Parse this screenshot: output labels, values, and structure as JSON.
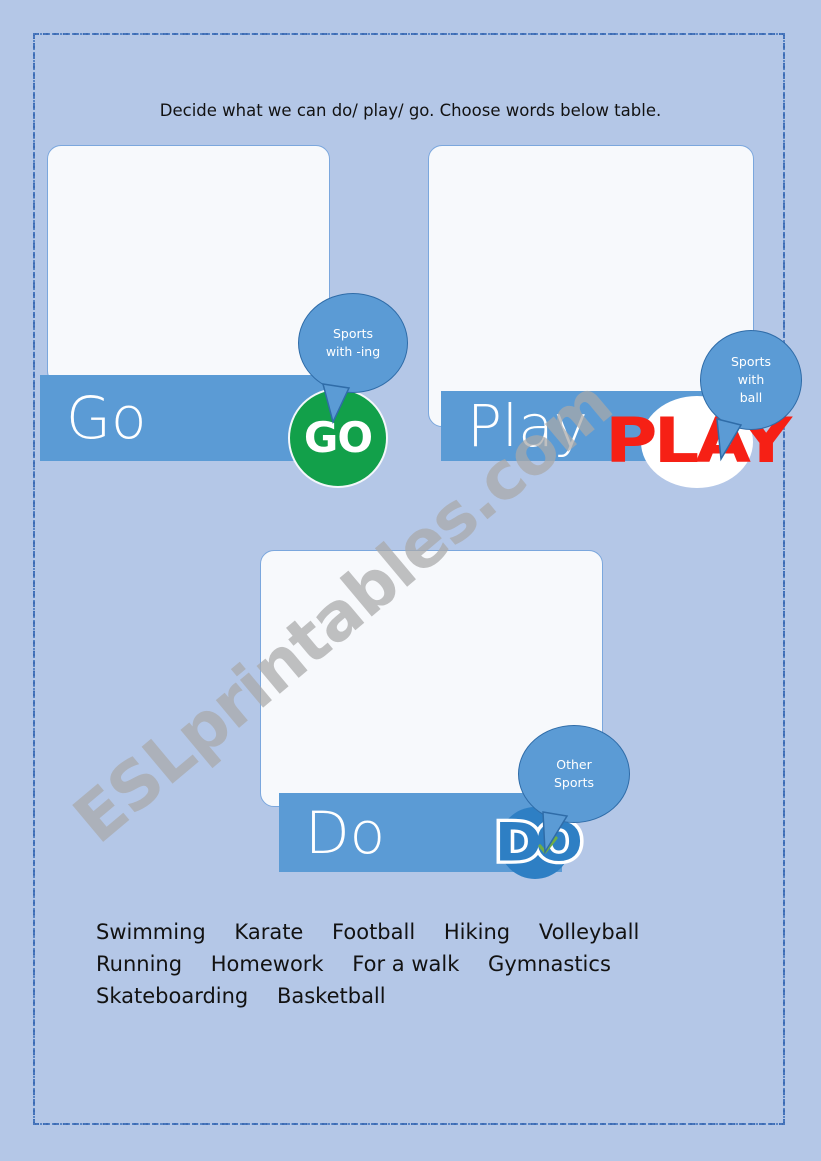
{
  "page": {
    "background_color": "#b4c7e7",
    "frame_color": "#4a7ac0",
    "accent_blue": "#5b9bd5",
    "card_fill": "#f7f9fc"
  },
  "instruction": {
    "text": "Decide what we can do/ play/ go. Choose words below table."
  },
  "watermark": {
    "text": "ESLprintables.com",
    "color": "#a9a9a9"
  },
  "groups": [
    {
      "id": "go",
      "label": "Go",
      "bubble_lines": [
        "Sports",
        "with -ing"
      ],
      "badge_text": "GO",
      "badge_color": "#12a04a",
      "badge_text_color": "#ffffff",
      "badge_icon": "go-stamp-icon"
    },
    {
      "id": "play",
      "label": "Play",
      "bubble_lines": [
        "Sports",
        "with",
        "ball"
      ],
      "badge_text": "PLAY",
      "badge_color": "#ffffff",
      "badge_text_color": "#f62015",
      "badge_icon": "play-stamp-icon"
    },
    {
      "id": "do",
      "label": "Do",
      "bubble_lines": [
        "Other",
        "Sports"
      ],
      "badge_text": "DO",
      "badge_color": "#2e7fc4",
      "badge_text_color": "#ffffff",
      "badge_icon": "do-check-icon",
      "check_color": "#70ad47"
    }
  ],
  "word_bank": {
    "rows": [
      [
        "Swimming",
        "Karate",
        "Football",
        "Hiking",
        "Volleyball"
      ],
      [
        "Running",
        "Homework",
        "For a walk",
        "Gymnastics"
      ],
      [
        "Skateboarding",
        "Basketball"
      ]
    ]
  }
}
